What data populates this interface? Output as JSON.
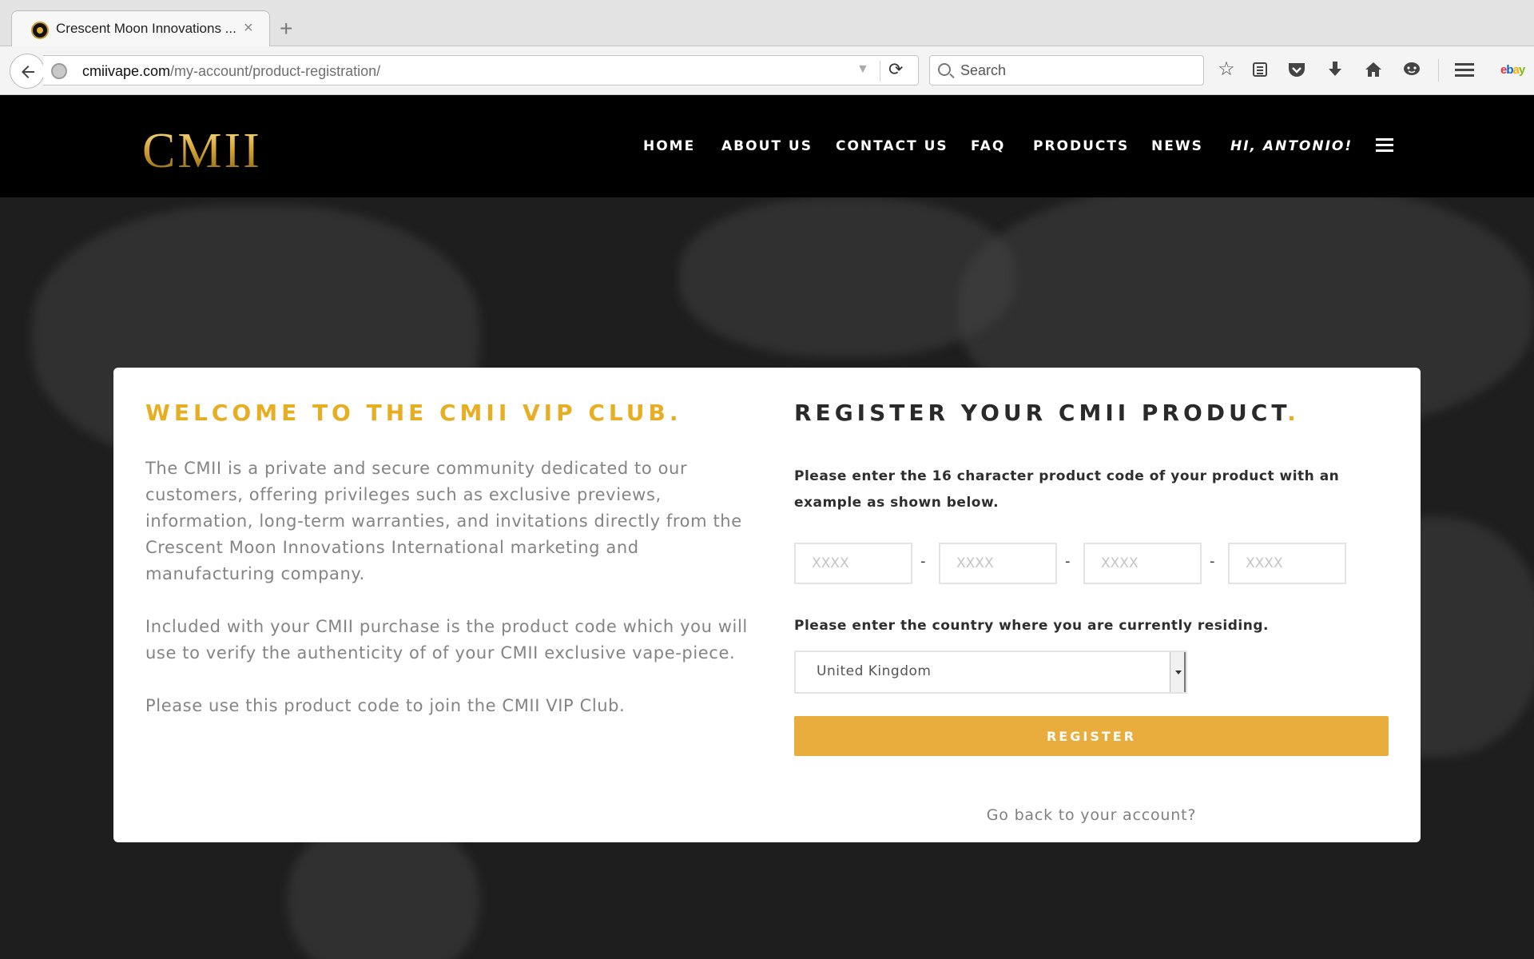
{
  "browser": {
    "tab_title": "Crescent Moon Innovations ...",
    "tab_close": "×",
    "new_tab": "+",
    "url_host": "cmiivape.com",
    "url_path": "/my-account/product-registration/",
    "search_placeholder": "Search",
    "toolbar_icons": [
      "bookmark-star-icon",
      "reading-list-icon",
      "pocket-icon",
      "download-icon",
      "home-icon",
      "chat-icon",
      "menu-icon"
    ],
    "ebay_label": [
      "e",
      "b",
      "a",
      "y"
    ]
  },
  "header": {
    "logo": "CMII",
    "nav": [
      "HOME",
      "ABOUT US",
      "CONTACT US",
      "FAQ",
      "PRODUCTS",
      "NEWS"
    ],
    "greeting": "HI, ANTONIO!"
  },
  "welcome": {
    "title": "WELCOME TO THE CMII VIP CLUB",
    "title_dot": ".",
    "paragraphs": [
      "The CMII is a private and secure community dedicated to our customers, offering privileges such as exclusive previews, information, long-term warranties, and invitations directly from the Crescent Moon Innovations International marketing and manufacturing company.",
      "Included with your CMII purchase is the product code which you will use to verify the authenticity of of your CMII exclusive vape-piece.",
      "Please use this product code to join the CMII VIP Club."
    ]
  },
  "register": {
    "title": "REGISTER YOUR CMII PRODUCT",
    "title_dot": ".",
    "code_instruction": "Please enter the 16 character product code of your product with an example as shown below.",
    "code_placeholders": [
      "XXXX",
      "XXXX",
      "XXXX",
      "XXXX"
    ],
    "code_separator": "-",
    "country_instruction": "Please enter the country where you are currently residing.",
    "country_selected": "United Kingdom",
    "register_label": "REGISTER",
    "back_link": "Go back to your account?"
  },
  "colors": {
    "accent": "#e5ae23",
    "button": "#e8ad3c",
    "header_bg": "#000000",
    "page_bg": "#1e1e1f"
  }
}
